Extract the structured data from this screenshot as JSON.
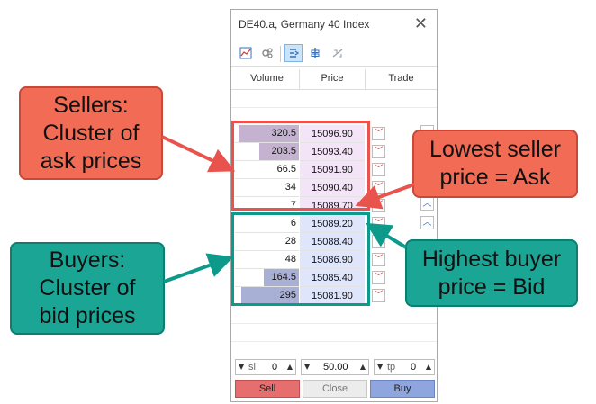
{
  "window": {
    "title": "DE40.a, Germany 40 Index",
    "close_glyph": "✕"
  },
  "toolbar": {
    "icons": [
      "chart-icon",
      "settings-icon",
      "trade-mode-icon",
      "depth-icon",
      "one-click-icon"
    ],
    "active_icon": "trade-mode-icon"
  },
  "columns": {
    "volume": "Volume",
    "price": "Price",
    "trade": "Trade"
  },
  "asks": [
    {
      "volume": "320.5",
      "price": "15096.90",
      "bar": 0.95
    },
    {
      "volume": "203.5",
      "price": "15093.40",
      "bar": 0.62
    },
    {
      "volume": "66.5",
      "price": "15091.90",
      "bar": 0.0
    },
    {
      "volume": "34",
      "price": "15090.40",
      "bar": 0.0
    },
    {
      "volume": "7",
      "price": "15089.70",
      "bar": 0.0
    }
  ],
  "bids": [
    {
      "volume": "6",
      "price": "15089.20",
      "bar": 0.0
    },
    {
      "volume": "28",
      "price": "15088.40",
      "bar": 0.0
    },
    {
      "volume": "48",
      "price": "15086.90",
      "bar": 0.0
    },
    {
      "volume": "164.5",
      "price": "15085.40",
      "bar": 0.55
    },
    {
      "volume": "295",
      "price": "15081.90",
      "bar": 0.9
    }
  ],
  "controls": {
    "sl_label": "sl",
    "sl_value": "0",
    "volume_value": "50.00",
    "tp_label": "tp",
    "tp_value": "0"
  },
  "buttons": {
    "sell": "Sell",
    "close": "Close",
    "buy": "Buy"
  },
  "annotations": {
    "sellers": "Sellers: Cluster of ask prices",
    "sellers_lines": [
      "Sellers:",
      "Cluster of",
      "ask prices"
    ],
    "lowest": "Lowest seller price = Ask",
    "lowest_lines": [
      "Lowest seller",
      "price = Ask"
    ],
    "buyers": "Buyers: Cluster of bid prices",
    "buyers_lines": [
      "Buyers:",
      "Cluster of",
      "bid prices"
    ],
    "highest": "Highest buyer price = Bid",
    "highest_lines": [
      "Highest buyer",
      "price = Bid"
    ]
  },
  "colors": {
    "callout_red": "#f26b55",
    "callout_teal": "#1aa595",
    "ask_price_bg": "#f4e4f8",
    "bid_price_bg": "#dfe6fb",
    "sell_button": "#e66e6e",
    "buy_button": "#8ea5dd"
  }
}
